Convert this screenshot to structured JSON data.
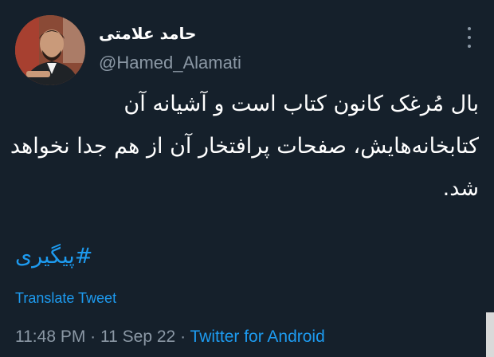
{
  "colors": {
    "background": "#15202b",
    "text": "#ffffff",
    "secondary": "#8b98a5",
    "accent": "#1d9bf0"
  },
  "author": {
    "display_name": "حامد علامتی",
    "handle": "@Hamed_Alamati",
    "avatar_icon": "profile-photo"
  },
  "menu": {
    "icon": "more-vertical-icon"
  },
  "tweet": {
    "text": "بال مُرغک کانون کتاب است و آشیانه آن کتابخانه‌هایش، صفحات پرافتخار آن از هم جدا نخواهد شد.",
    "hashtag": "#پیگیری",
    "translate_label": "Translate Tweet",
    "time": "11:48 PM",
    "separator": "·",
    "date": "11 Sep 22",
    "source": "Twitter for Android"
  }
}
